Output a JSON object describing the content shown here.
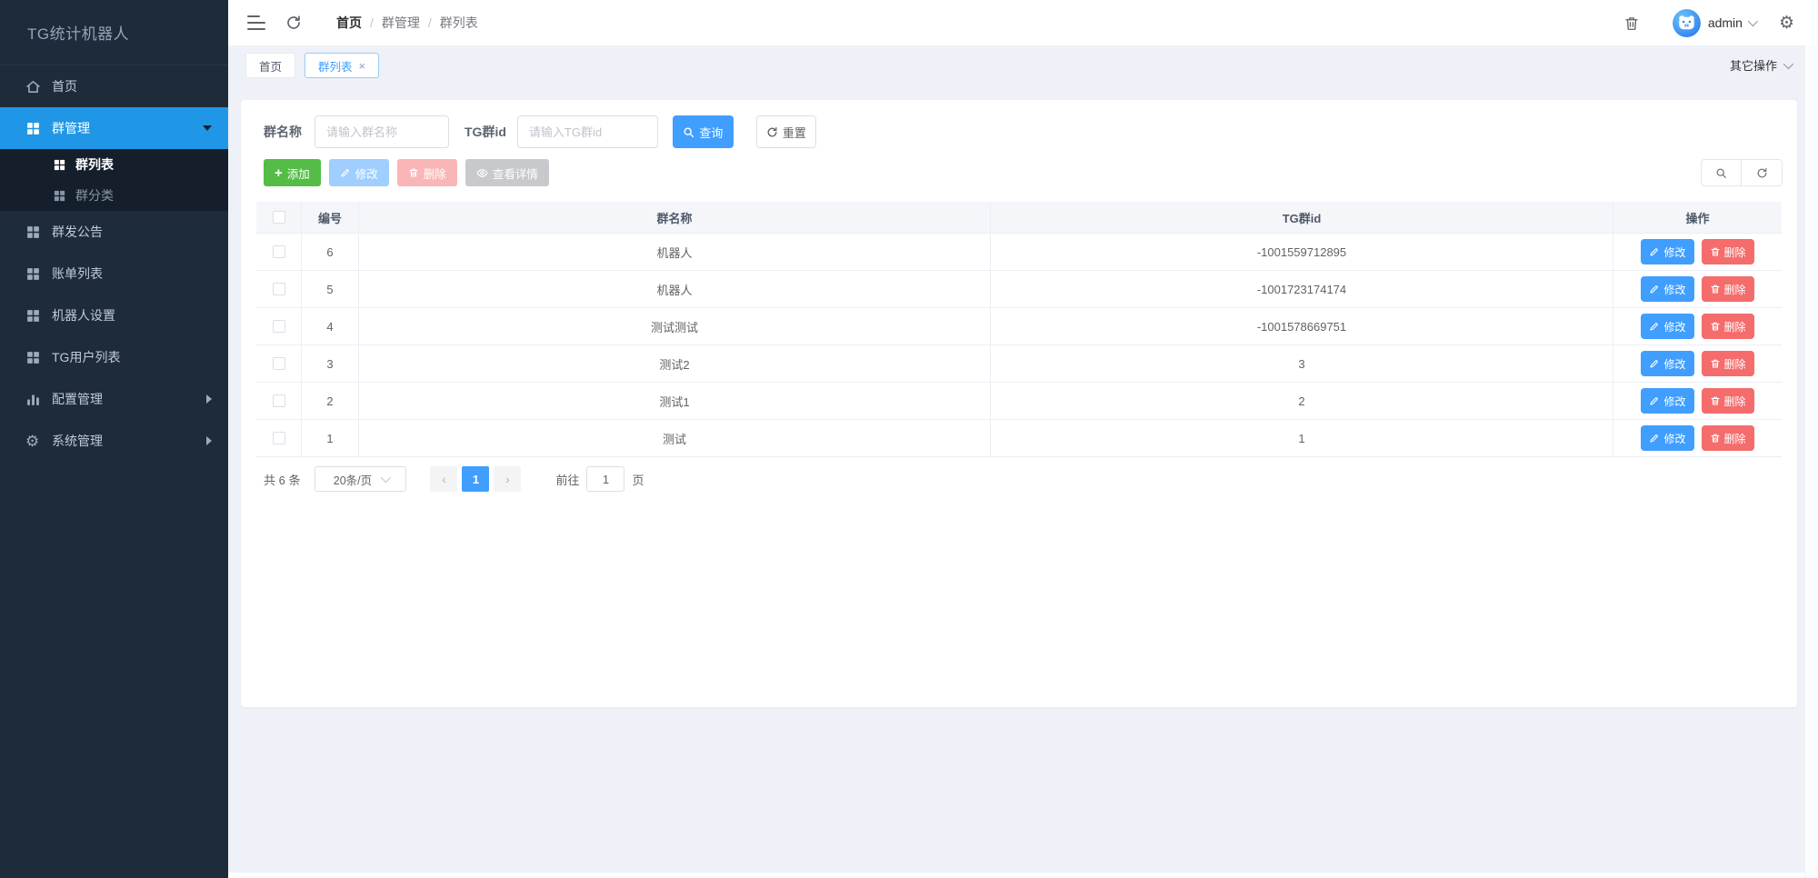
{
  "app": {
    "title": "TG统计机器人"
  },
  "colors": {
    "primary": "#409eff",
    "success": "#55bd47",
    "danger": "#f56c6c",
    "sidebar_bg": "#1d2b3b",
    "sidebar_active_bg": "#2097e6",
    "disabled_primary": "#a0cfff",
    "disabled_danger": "#fab6b6",
    "disabled_info": "#c8c9cc"
  },
  "sidebar": {
    "items": [
      {
        "label": "首页",
        "icon": "home-icon"
      },
      {
        "label": "群管理",
        "icon": "grid-icon",
        "expanded": true,
        "active": true
      },
      {
        "label": "群发公告",
        "icon": "grid-icon"
      },
      {
        "label": "账单列表",
        "icon": "grid-icon"
      },
      {
        "label": "机器人设置",
        "icon": "grid-icon"
      },
      {
        "label": "TG用户列表",
        "icon": "grid-icon"
      },
      {
        "label": "配置管理",
        "icon": "bar-chart-icon",
        "has_children": true
      },
      {
        "label": "系统管理",
        "icon": "gear-icon",
        "has_children": true
      }
    ],
    "submenu": [
      {
        "label": "群列表",
        "active": true
      },
      {
        "label": "群分类"
      }
    ]
  },
  "header": {
    "breadcrumb": {
      "home": "首页",
      "section": "群管理",
      "page": "群列表"
    },
    "username": "admin"
  },
  "tabs": {
    "home": "首页",
    "current": "群列表"
  },
  "more_actions_label": "其它操作",
  "filters": {
    "group_name_label": "群名称",
    "group_name_placeholder": "请输入群名称",
    "tg_group_id_label": "TG群id",
    "tg_group_id_placeholder": "请输入TG群id",
    "search_label": "查询",
    "reset_label": "重置"
  },
  "toolbar": {
    "add_label": "添加",
    "edit_label": "修改",
    "delete_label": "删除",
    "detail_label": "查看详情"
  },
  "table": {
    "columns": {
      "id": "编号",
      "name": "群名称",
      "tgid": "TG群id",
      "ops": "操作"
    },
    "row_edit_label": "修改",
    "row_delete_label": "删除",
    "rows": [
      {
        "id": "6",
        "name": "机器人",
        "tgid": "-1001559712895"
      },
      {
        "id": "5",
        "name": "机器人",
        "tgid": "-1001723174174"
      },
      {
        "id": "4",
        "name": "测试测试",
        "tgid": "-1001578669751"
      },
      {
        "id": "3",
        "name": "测试2",
        "tgid": "3"
      },
      {
        "id": "2",
        "name": "测试1",
        "tgid": "2"
      },
      {
        "id": "1",
        "name": "测试",
        "tgid": "1"
      }
    ]
  },
  "pagination": {
    "total_label": "共 6 条",
    "page_size_label": "20条/页",
    "prev_glyph": "‹",
    "next_glyph": "›",
    "current_page": "1",
    "goto_label": "前往",
    "goto_value": "1",
    "page_unit_label": "页"
  }
}
